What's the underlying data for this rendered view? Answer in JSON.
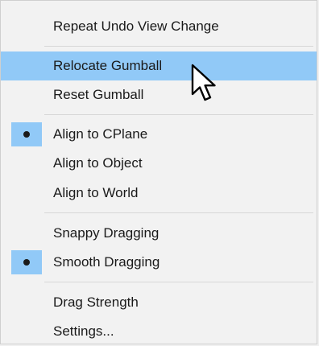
{
  "menu": {
    "items": [
      {
        "label": "Repeat Undo View Change"
      },
      {
        "label": "Relocate Gumball"
      },
      {
        "label": "Reset Gumball"
      },
      {
        "label": "Align to CPlane",
        "checked": true
      },
      {
        "label": "Align to Object"
      },
      {
        "label": "Align to World"
      },
      {
        "label": "Snappy Dragging"
      },
      {
        "label": "Smooth Dragging",
        "checked": true
      },
      {
        "label": "Drag Strength"
      },
      {
        "label": "Settings..."
      }
    ],
    "highlighted_item": "Relocate Gumball",
    "accent_color": "#91c9f7"
  },
  "cursor": {
    "icon": "arrow-pointer-icon"
  }
}
